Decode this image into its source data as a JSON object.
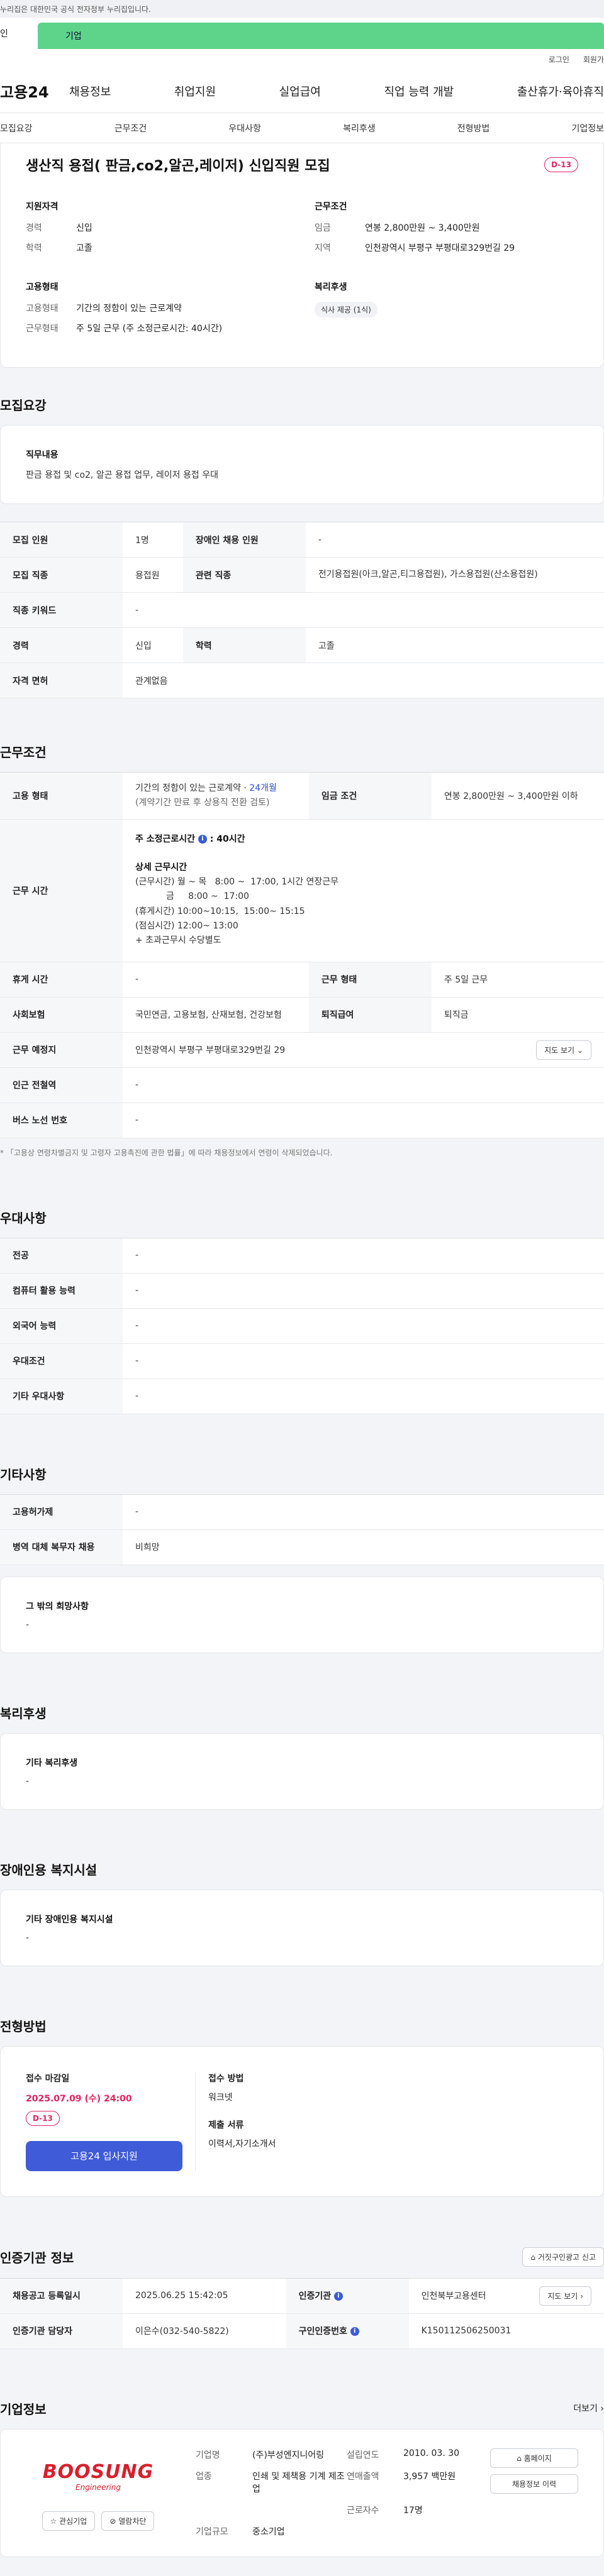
{
  "gov_bar": {
    "text": "누리집은 대한민국 공식 전자정부 누리집입니다."
  },
  "topbar": {
    "personal": "인",
    "company": "기업"
  },
  "util": {
    "login": "로그인",
    "join": "회원가"
  },
  "gnb": {
    "logo": "고용24",
    "menu": [
      "채용정보",
      "취업지원",
      "실업급여",
      "직업 능력 개발",
      "출산휴가·육아휴직"
    ]
  },
  "anchor_tabs": [
    "모집요강",
    "근무조건",
    "우대사항",
    "복리후생",
    "전형방법",
    "기업정보"
  ],
  "header": {
    "title": "생산직 용접( 판금,co2,알곤,레이저) 신입직원 모집",
    "dday": "D-13",
    "qual_title": "지원자격",
    "career_k": "경력",
    "career_v": "신입",
    "edu_k": "학력",
    "edu_v": "고졸",
    "cond_title": "근무조건",
    "wage_k": "임금",
    "wage_v": "연봉 2,800만원 ~ 3,400만원",
    "region_k": "지역",
    "region_v": "인천광역시 부평구 부평대로329번길 29",
    "emp_title": "고용형태",
    "emp_type_k": "고용형태",
    "emp_type_v": "기간의 정함이 있는 근로계약",
    "work_type_k": "근무형태",
    "work_type_v": "주 5일 근무 (주 소정근로시간: 40시간)",
    "welfare_title": "복리후생",
    "welfare_pill": "식사 제공 (1식)"
  },
  "recruit": {
    "title": "모집요강",
    "duty_title": "직무내용",
    "duty_text": "판금 용접 및 co2, 알곤 용접 업무, 레이저 용접 우대",
    "rows": {
      "count_k": "모집 인원",
      "count_v": "1명",
      "disabled_k": "장애인 채용 인원",
      "disabled_v": "-",
      "job_k": "모집 직종",
      "job_v": "용접원",
      "related_k": "관련 직종",
      "related_v": "전기용접원(아크,알곤,티그용접원), 가스용접원(산소용접원)",
      "keyword_k": "직종 키워드",
      "keyword_v": "-",
      "career_k": "경력",
      "career_v": "신입",
      "edu_k": "학력",
      "edu_v": "고졸",
      "license_k": "자격 면허",
      "license_v": "관계없음"
    }
  },
  "work": {
    "title": "근무조건",
    "emp_k": "고용 형태",
    "emp_v1": "기간의 정함이 있는 근로계약 · ",
    "emp_v1_blue": "24개월",
    "emp_v2": "(계약기간 만료 후 상용직 전환 검토)",
    "wage_k": "임금 조건",
    "wage_v": "연봉 2,800만원 ~ 3,400만원 이하",
    "hours_k": "근무 시간",
    "hours_main": "주 소정근로시간",
    "hours_info": "i",
    "hours_main_v": ": 40시간",
    "hours_detail_title": "상세 근무시간",
    "hours_l1": "(근무시간) 월 ~ 목   8:00 ~  17:00, 1시간 연장근무",
    "hours_l2": "           금     8:00 ~  17:00",
    "hours_l3": "(휴게시간) 10:00~10:15,  15:00~ 15:15",
    "hours_l4": "(점심시간) 12:00~ 13:00",
    "hours_l5": "+ 초과근무시 수당별도",
    "holiday_k": "휴게 시간",
    "holiday_v": "-",
    "worktype_k": "근무 형태",
    "worktype_v": "주 5일 근무",
    "insurance_k": "사회보험",
    "insurance_v": "국민연금, 고용보험, 산재보험, 건강보험",
    "retire_k": "퇴직급여",
    "retire_v": "퇴직금",
    "place_k": "근무 예정지",
    "place_v": "인천광역시 부평구 부평대로329번길 29",
    "map_btn": "지도 보기",
    "subway_k": "인근 전철역",
    "subway_v": "-",
    "bus_k": "버스 노선 번호",
    "bus_v": "-",
    "note": "* 「고용상 연령차별금지 및 고령자 고용촉진에 관한 법률」에 따라 채용정보에서 연령이 삭제되었습니다."
  },
  "prefer": {
    "title": "우대사항",
    "major_k": "전공",
    "major_v": "-",
    "computer_k": "컴퓨터 활용 능력",
    "computer_v": "-",
    "lang_k": "외국어 능력",
    "lang_v": "-",
    "cond_k": "우대조건",
    "cond_v": "-",
    "etc_k": "기타 우대사항",
    "etc_v": "-"
  },
  "etc": {
    "title": "기타사항",
    "military_k": "고용허가제",
    "military_v": "-",
    "alt_k": "병역 대체 복무자 채용",
    "alt_v": "비희망",
    "wish_title": "그 밖의 희망사항",
    "wish_v": "-"
  },
  "welfare": {
    "title": "복리후생",
    "etc_title": "기타 복리후생",
    "etc_v": "-"
  },
  "disabled_fac": {
    "title": "장애인용 복지시설",
    "etc_title": "기타 장애인용 복지시설",
    "etc_v": "-"
  },
  "process": {
    "title": "전형방법",
    "deadline_title": "접수 마감일",
    "deadline": "2025.07.09 (수) 24:00",
    "dday": "D-13",
    "apply_btn": "고용24 입사지원",
    "method_title": "접수 방법",
    "method_v": "워크넷",
    "docs_title": "제출 서류",
    "docs_v": "이력서,자기소개서"
  },
  "agency": {
    "title": "인증기관 정보",
    "report_btn": "거짓구인광고 신고",
    "reg_k": "채용공고 등록일시",
    "reg_v": "2025.06.25 15:42:05",
    "org_k": "인증기관",
    "org_v": "인천북부고용센터",
    "map_btn": "지도 보기",
    "manager_k": "인증기관 담당자",
    "manager_v": "이은수(032-540-5822)",
    "num_k": "구인인증번호",
    "num_v": "K150112506250031",
    "info": "i"
  },
  "company": {
    "title": "기업정보",
    "more": "더보기",
    "logo_text": "BOOSUNG",
    "logo_sub": "Engineering",
    "fav_btn": "관심기업",
    "block_btn": "열람차단",
    "name_k": "기업명",
    "name_v": "(주)부성엔지니어링",
    "found_k": "설립연도",
    "found_v": "2010. 03. 30",
    "industry_k": "업종",
    "industry_v": "인쇄 및 제책용 기계 제조업",
    "sales_k": "연매출액",
    "sales_v": "3,957 백만원",
    "emp_k": "근로자수",
    "emp_v": "17명",
    "size_k": "기업규모",
    "size_v": "중소기업",
    "home_btn": "홈페이지",
    "jobs_btn": "채용정보 이력"
  }
}
